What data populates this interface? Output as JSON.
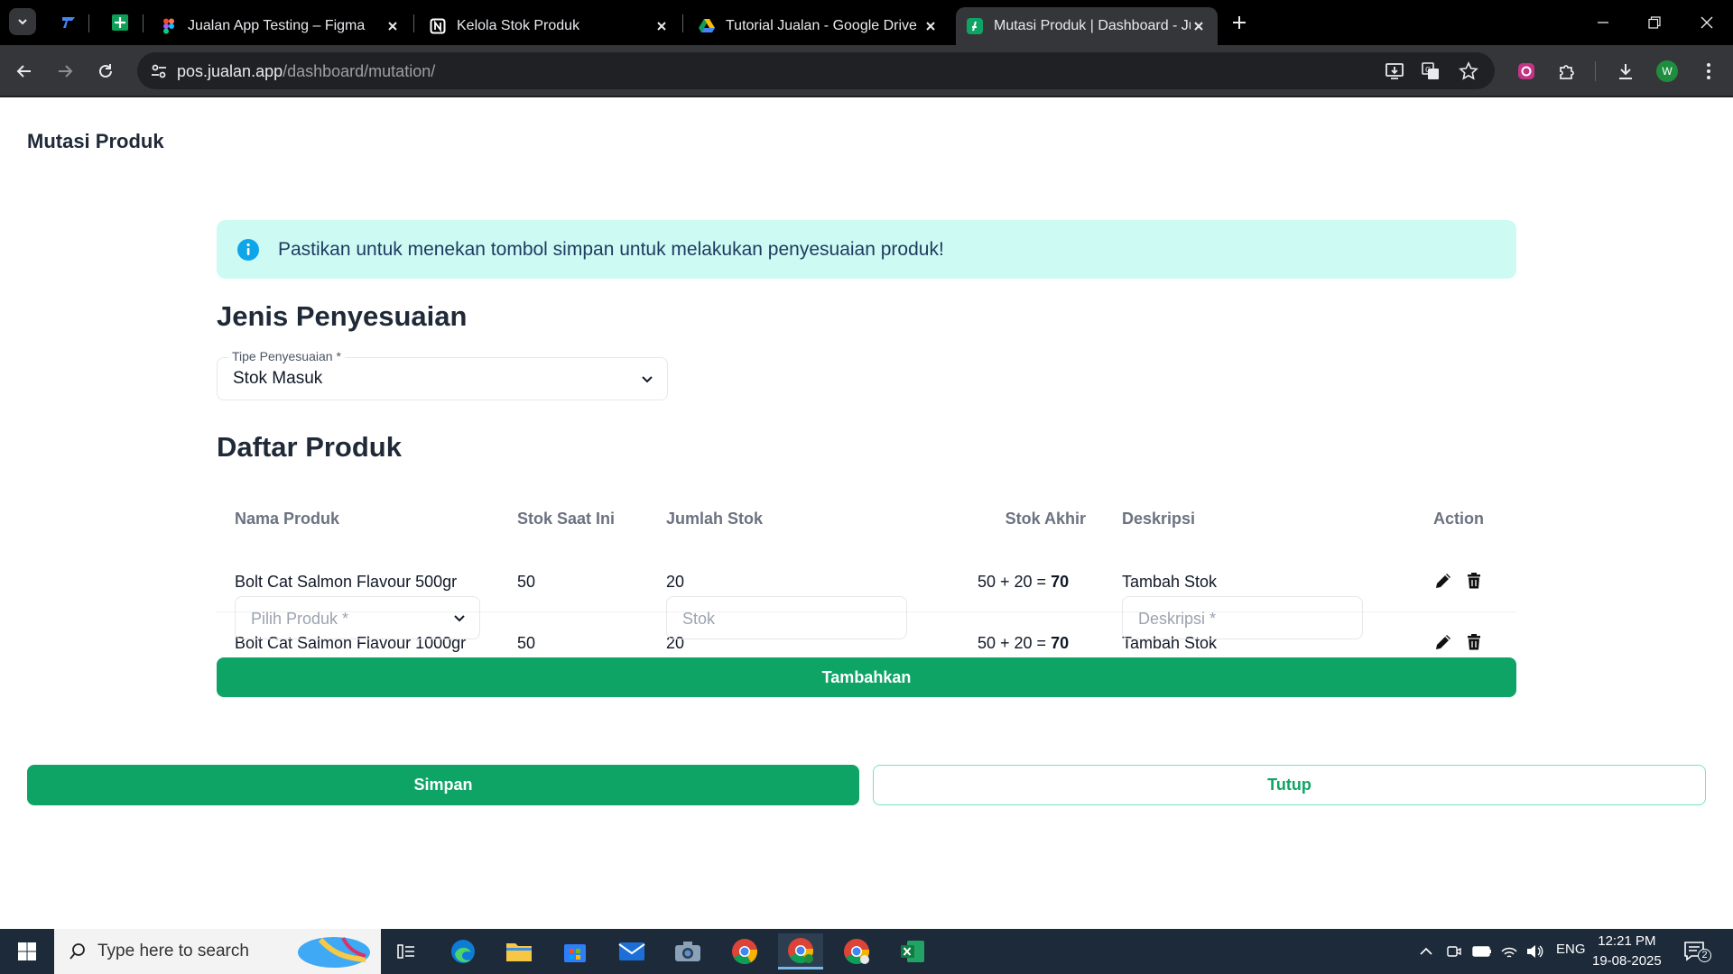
{
  "browser": {
    "tabs": [
      {
        "title": "Jualan App Testing – Figma"
      },
      {
        "title": "Kelola Stok Produk"
      },
      {
        "title": "Tutorial Jualan - Google Drive"
      },
      {
        "title": "Mutasi Produk | Dashboard - Ju"
      }
    ],
    "url_host": "pos.jualan.app",
    "url_path": "/dashboard/mutation/",
    "profile_initial": "W"
  },
  "page": {
    "title": "Mutasi Produk",
    "alert": "Pastikan untuk menekan tombol simpan untuk melakukan penyesuaian produk!",
    "section_adjust": "Jenis Penyesuaian",
    "tipe_label": "Tipe Penyesuaian *",
    "tipe_value": "Stok Masuk",
    "section_products": "Daftar Produk",
    "columns": [
      "Nama Produk",
      "Stok Saat Ini",
      "Jumlah Stok",
      "Stok Akhir",
      "Deskripsi",
      "Action"
    ],
    "rows": [
      {
        "name": "Bolt Cat Salmon Flavour 500gr",
        "current": "50",
        "qty": "20",
        "calc": "50 + 20 = ",
        "final": "70",
        "desc": "Tambah Stok"
      },
      {
        "name": "Bolt Cat Salmon Flavour 1000gr",
        "current": "50",
        "qty": "20",
        "calc": "50 + 20 = ",
        "final": "70",
        "desc": "Tambah Stok"
      }
    ],
    "pilih_produk_placeholder": "Pilih Produk *",
    "stok_placeholder": "Stok",
    "deskripsi_placeholder": "Deskripsi *",
    "add_button": "Tambahkan",
    "save_button": "Simpan",
    "close_button": "Tutup"
  },
  "taskbar": {
    "search_placeholder": "Type here to search",
    "lang": "ENG",
    "time": "12:21 PM",
    "date": "19-08-2025",
    "notifications": "2"
  },
  "colors": {
    "primary": "#0ea465",
    "alert_bg": "#cdfaf3",
    "info_icon": "#0ea5e9"
  }
}
